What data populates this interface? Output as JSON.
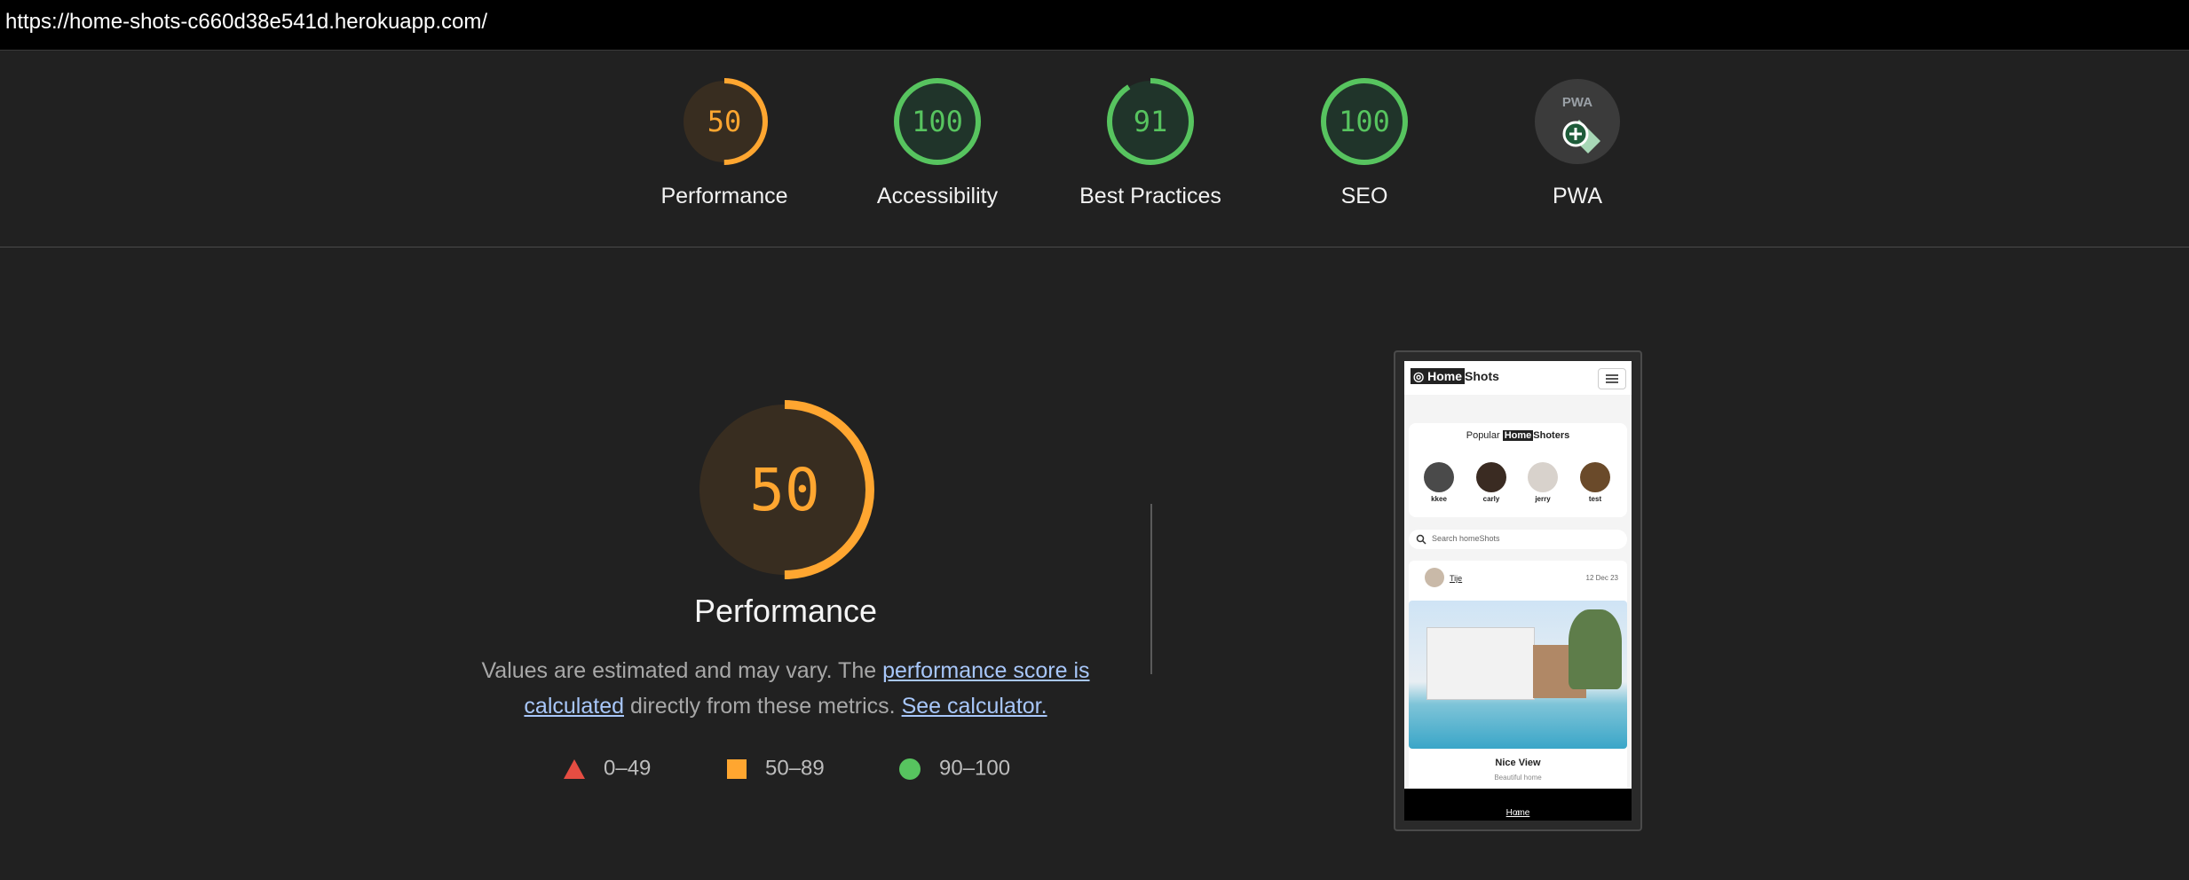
{
  "url": "https://home-shots-c660d38e541d.herokuapp.com/",
  "colors": {
    "orange": "#ffa630",
    "green": "#57c45f",
    "red": "#e54d42",
    "link": "#a8c7fa"
  },
  "categories": [
    {
      "label": "Performance",
      "score": "50",
      "fraction": 0.5,
      "color": "#ffa630"
    },
    {
      "label": "Accessibility",
      "score": "100",
      "fraction": 1.0,
      "color": "#57c45f"
    },
    {
      "label": "Best Practices",
      "score": "91",
      "fraction": 0.91,
      "color": "#57c45f"
    },
    {
      "label": "SEO",
      "score": "100",
      "fraction": 1.0,
      "color": "#57c45f"
    },
    {
      "label": "PWA",
      "icon": "pwa-icon",
      "score": "PWA"
    }
  ],
  "main": {
    "score": "50",
    "fraction": 0.5,
    "title": "Performance",
    "desc_pre": "Values are estimated and may vary. The ",
    "desc_link1": "performance score is calculated",
    "desc_mid": " directly from these metrics. ",
    "desc_link2": "See calculator."
  },
  "legend": [
    {
      "shape": "triangle",
      "label": "0–49"
    },
    {
      "shape": "square",
      "label": "50–89"
    },
    {
      "shape": "circle",
      "label": "90–100"
    }
  ],
  "phone": {
    "logo_home": "Home",
    "logo_shots": "Shots",
    "popular_pre": "Popular",
    "popular_home": "Home",
    "popular_post": "Shoters",
    "users": [
      "kkee",
      "carly",
      "jerry",
      "test"
    ],
    "search_placeholder": "Search homeShots",
    "post_user": "Tije",
    "post_date": "12 Dec 23",
    "post_title": "Nice View",
    "post_subtitle": "Beautiful home",
    "footer": "Home"
  }
}
